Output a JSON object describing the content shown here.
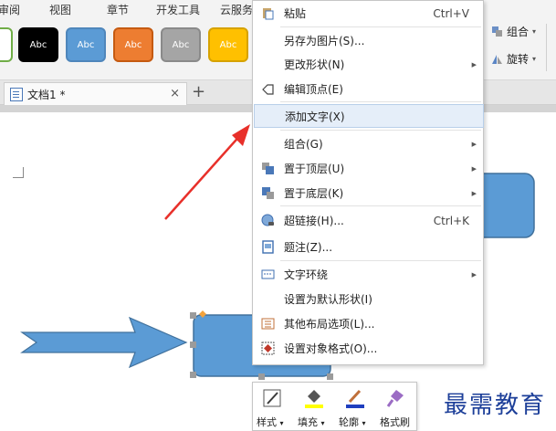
{
  "menubar": {
    "items": [
      "审阅",
      "视图",
      "章节",
      "开发工具",
      "云服务"
    ]
  },
  "ribbon": {
    "style_swatches": [
      {
        "label": "Abc",
        "color": "#000000"
      },
      {
        "label": "Abc",
        "color": "#5b9bd5"
      },
      {
        "label": "Abc",
        "color": "#ed7d31"
      },
      {
        "label": "Abc",
        "color": "#a5a5a5"
      },
      {
        "label": "Abc",
        "color": "#ffc000"
      }
    ],
    "group_label": "组合",
    "rotate_label": "旋转"
  },
  "tabs": {
    "doc_tab": "文档1 *",
    "close_glyph": "×",
    "add_glyph": "+"
  },
  "context_menu": {
    "items": [
      {
        "id": "paste",
        "label": "粘贴",
        "shortcut": "Ctrl+V",
        "icon": "paste-icon"
      },
      {
        "id": "save-as-image",
        "label": "另存为图片(S)..."
      },
      {
        "id": "change-shape",
        "label": "更改形状(N)",
        "submenu": true
      },
      {
        "id": "edit-points",
        "label": "编辑顶点(E)",
        "icon": "edit-points-icon"
      },
      {
        "id": "add-text",
        "label": "添加文字(X)",
        "highlighted": true
      },
      {
        "id": "group",
        "label": "组合(G)",
        "submenu": true
      },
      {
        "id": "bring-to-front",
        "label": "置于顶层(U)",
        "icon": "bring-front-icon",
        "submenu": true
      },
      {
        "id": "send-to-back",
        "label": "置于底层(K)",
        "icon": "send-back-icon",
        "submenu": true
      },
      {
        "id": "hyperlink",
        "label": "超链接(H)...",
        "shortcut": "Ctrl+K",
        "icon": "hyperlink-icon"
      },
      {
        "id": "caption",
        "label": "题注(Z)...",
        "icon": "caption-icon"
      },
      {
        "id": "text-wrap",
        "label": "文字环绕",
        "icon": "text-wrap-icon",
        "submenu": true
      },
      {
        "id": "set-default-shape",
        "label": "设置为默认形状(I)"
      },
      {
        "id": "other-layout",
        "label": "其他布局选项(L)...",
        "icon": "layout-icon"
      },
      {
        "id": "format-object",
        "label": "设置对象格式(O)...",
        "icon": "format-object-icon"
      }
    ]
  },
  "mini_toolbar": {
    "buttons": [
      {
        "label": "样式",
        "icon": "style-icon"
      },
      {
        "label": "填充",
        "icon": "fill-icon"
      },
      {
        "label": "轮廓",
        "icon": "outline-icon"
      },
      {
        "label": "格式刷",
        "icon": "format-painter-icon"
      }
    ],
    "dropdown_glyph": "▾"
  },
  "watermark": "最需教育",
  "colors": {
    "shape_fill": "#5b9bd5",
    "shape_stroke": "#41719c",
    "arrow_red": "#e8302a",
    "highlight": "#e5eef9"
  }
}
